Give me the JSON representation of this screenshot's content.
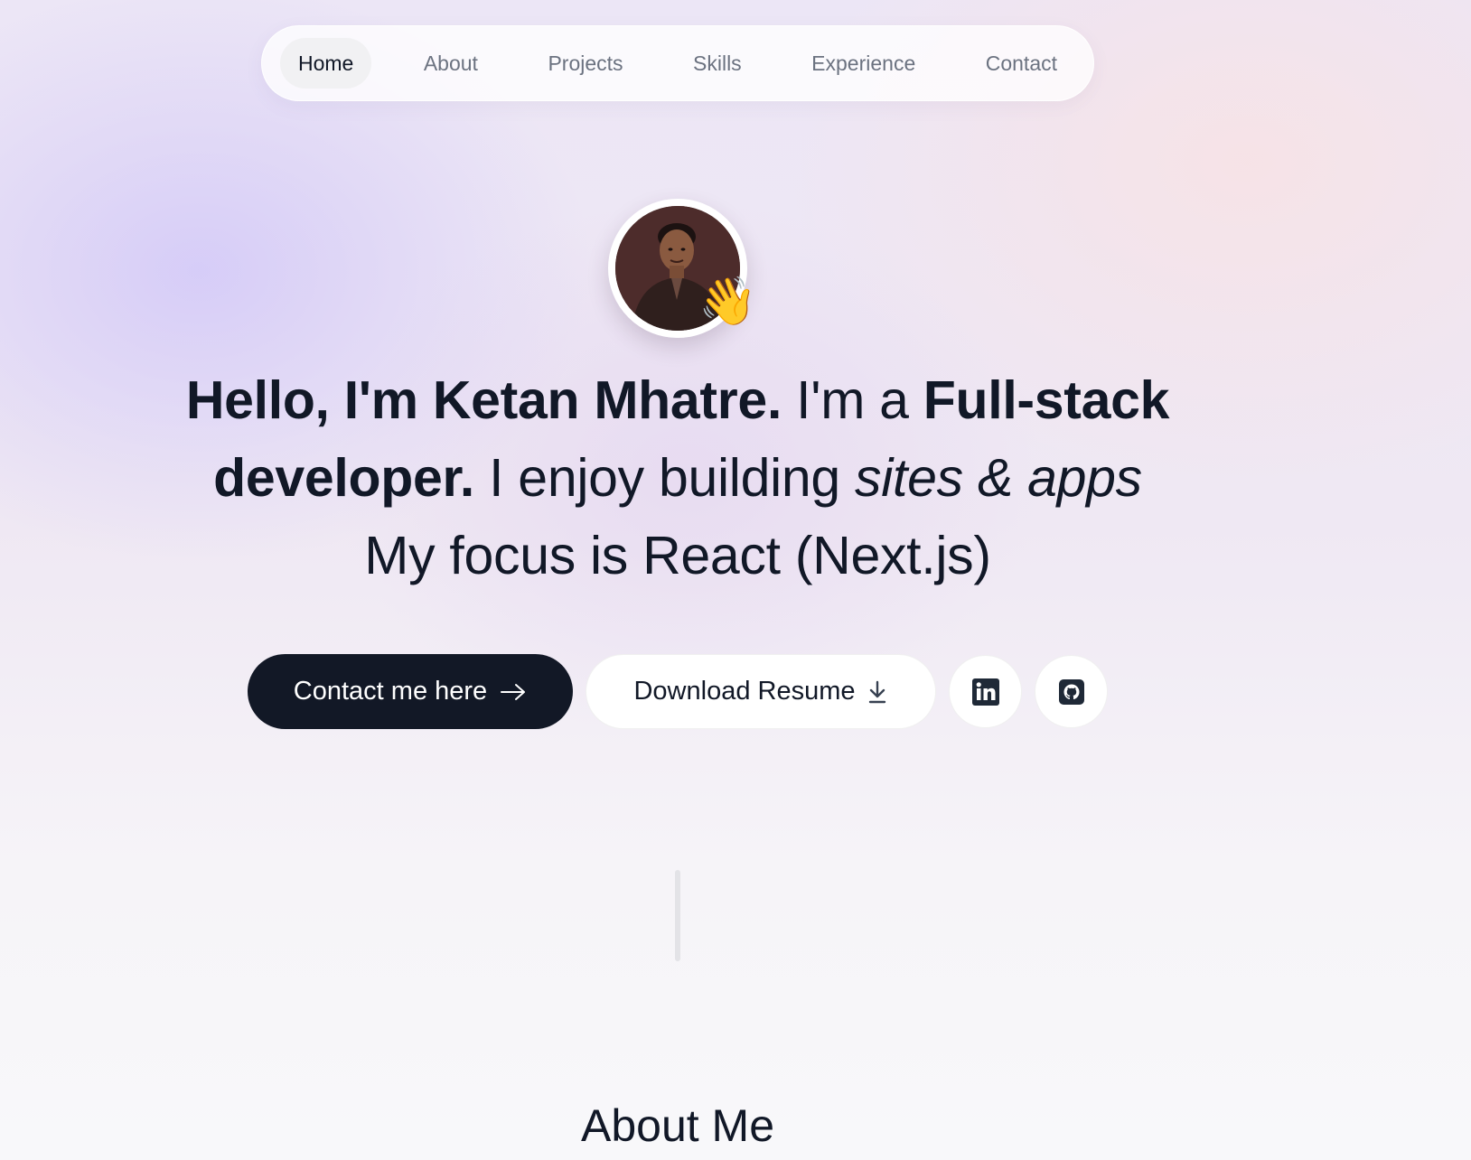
{
  "nav": {
    "items": [
      {
        "label": "Home",
        "active": true
      },
      {
        "label": "About",
        "active": false
      },
      {
        "label": "Projects",
        "active": false
      },
      {
        "label": "Skills",
        "active": false
      },
      {
        "label": "Experience",
        "active": false
      },
      {
        "label": "Contact",
        "active": false
      }
    ]
  },
  "hero": {
    "avatar_badge": "👋",
    "headline": {
      "part1_bold": "Hello, I'm Ketan Mhatre.",
      "part2": " I'm a ",
      "part3_bold": "Full-stack developer.",
      "part4": " I enjoy building ",
      "part5_italic": "sites & apps",
      "part6": "My focus is React (Next.js)"
    },
    "buttons": {
      "contact_label": "Contact me here",
      "contact_icon": "→",
      "resume_label": "Download Resume",
      "resume_icon": "download-icon",
      "linkedin_icon": "linkedin-icon",
      "github_icon": "github-icon"
    }
  },
  "about": {
    "title": "About Me"
  },
  "colors": {
    "primary_button": "#121826",
    "text": "#111827",
    "muted_text": "#6b7280",
    "icon": "#1f2937"
  }
}
